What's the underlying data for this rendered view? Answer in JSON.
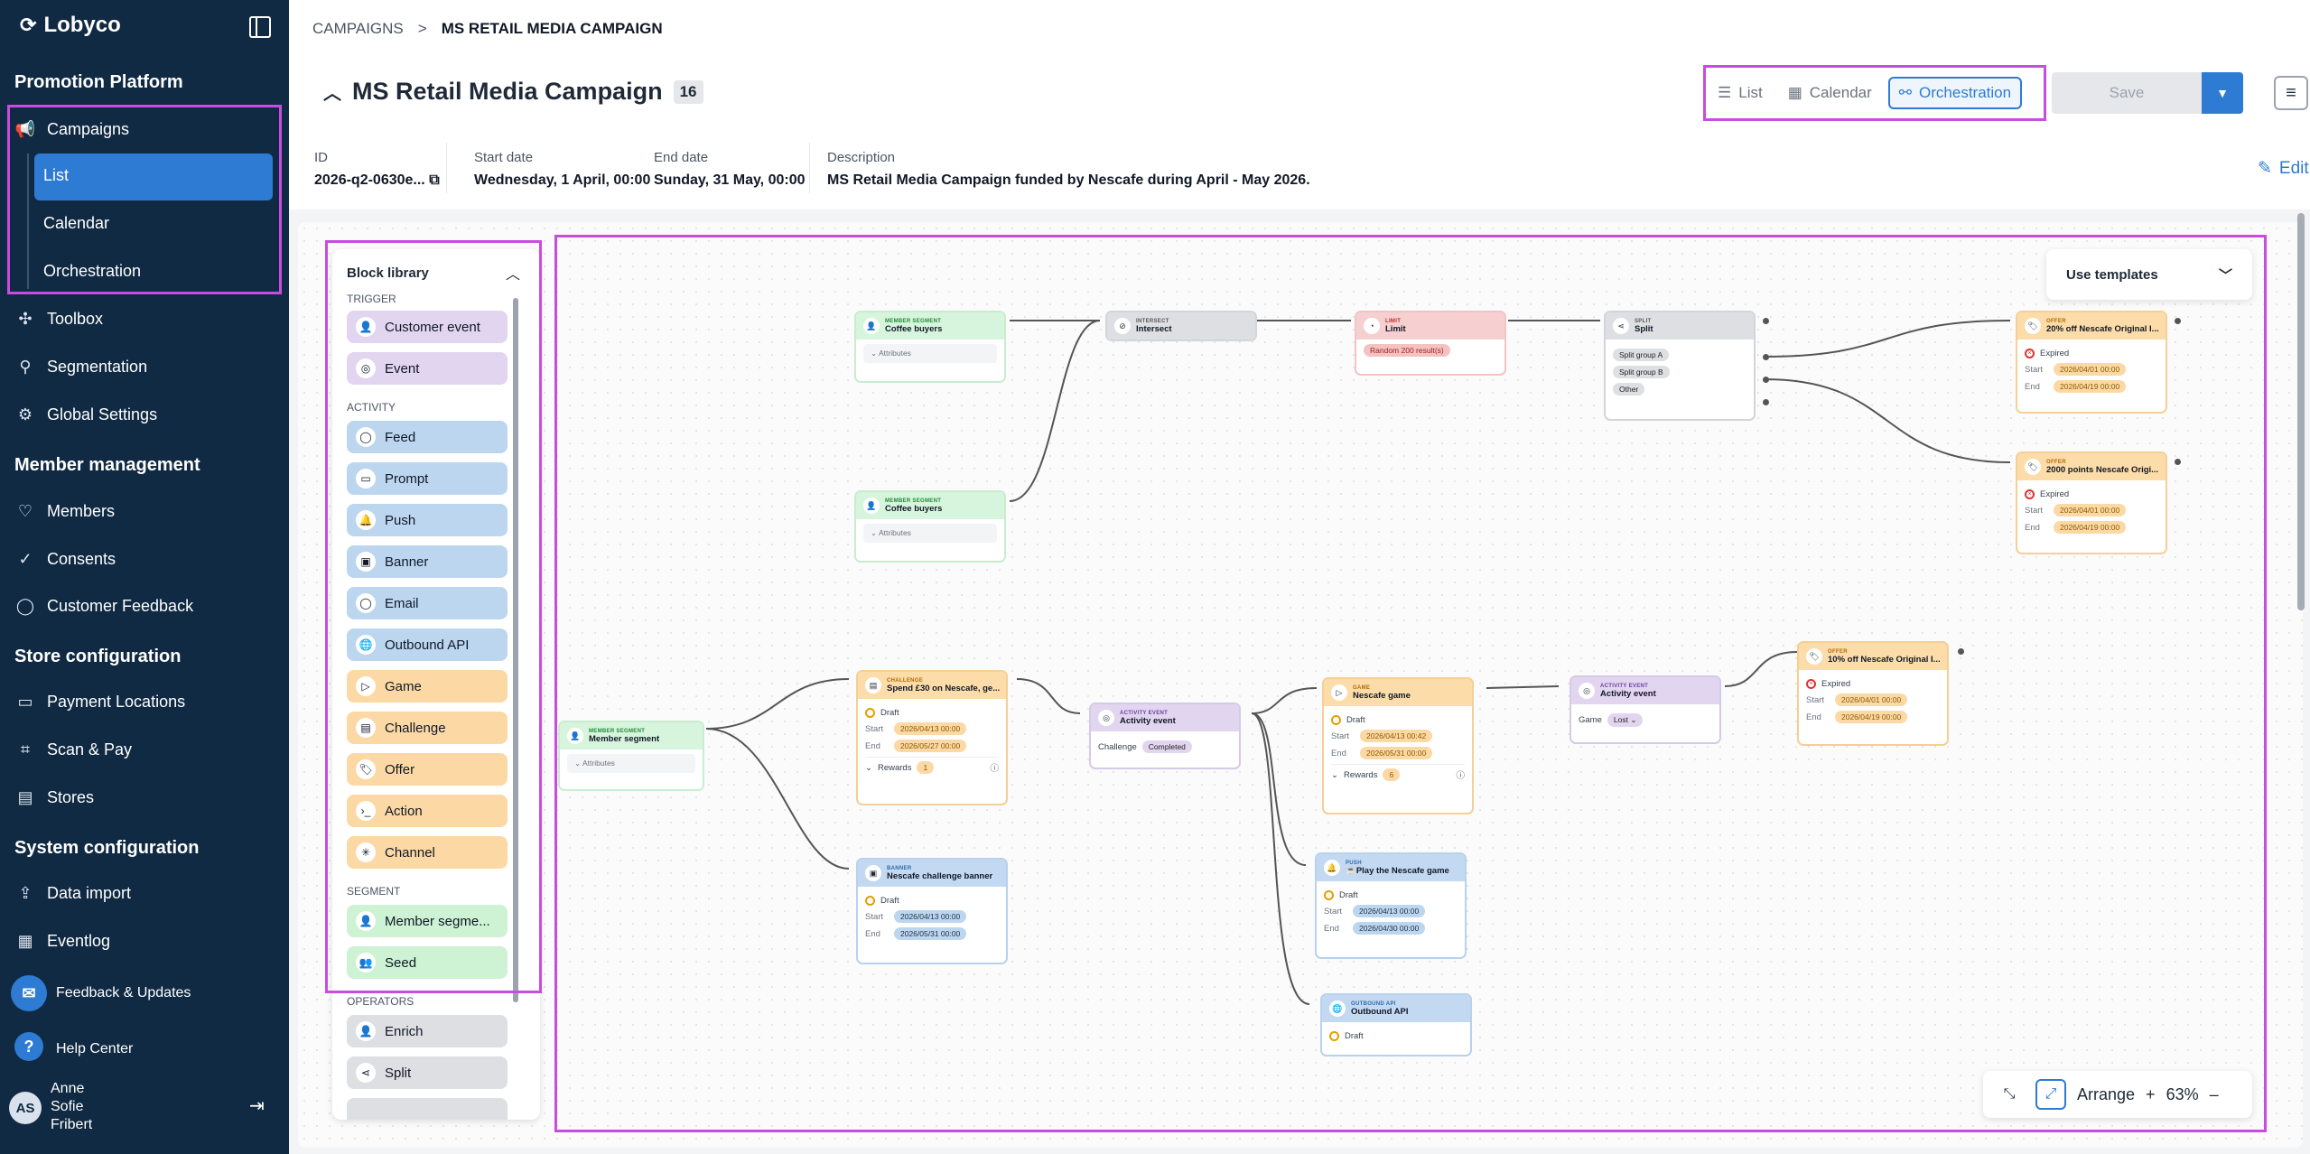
{
  "app": {
    "logo": "Lobyco"
  },
  "sidebar": {
    "sections": [
      "Promotion Platform",
      "Member management",
      "Store configuration",
      "System configuration"
    ],
    "campaigns": "Campaigns",
    "sub_items": [
      "List",
      "Calendar",
      "Orchestration"
    ],
    "toolbox": "Toolbox",
    "segmentation": "Segmentation",
    "global_settings": "Global Settings",
    "members": "Members",
    "consents": "Consents",
    "customer_feedback": "Customer Feedback",
    "payment_locations": "Payment Locations",
    "scan_pay": "Scan & Pay",
    "stores": "Stores",
    "data_import": "Data import",
    "eventlog": "Eventlog",
    "feedback_updates": "Feedback & Updates",
    "help_center": "Help Center",
    "user_initials": "AS",
    "user_name": [
      "Anne",
      "Sofie",
      "Fribert"
    ]
  },
  "breadcrumb": {
    "root": "CAMPAIGNS",
    "sep": ">",
    "current": "MS RETAIL MEDIA CAMPAIGN"
  },
  "campaign": {
    "title": "MS Retail Media Campaign",
    "count": "16",
    "id_label": "ID",
    "id_value": "2026-q2-0630e...",
    "start_label": "Start date",
    "start_value": "Wednesday, 1 April, 00:00",
    "end_label": "End date",
    "end_value": "Sunday, 31 May, 00:00",
    "desc_label": "Description",
    "desc_value": "MS Retail Media Campaign funded by Nescafe during April - May 2026.",
    "edit": "Edit"
  },
  "views": {
    "list": "List",
    "calendar": "Calendar",
    "orchestration": "Orchestration",
    "active": "Orchestration"
  },
  "save": "Save",
  "library": {
    "title": "Block library",
    "trigger_label": "TRIGGER",
    "trigger": [
      "Customer event",
      "Event"
    ],
    "activity_label": "ACTIVITY",
    "activity_blue": [
      "Feed",
      "Prompt",
      "Push",
      "Banner",
      "Email",
      "Outbound API"
    ],
    "activity_orange": [
      "Game",
      "Challenge",
      "Offer",
      "Action",
      "Channel"
    ],
    "segment_label": "SEGMENT",
    "segment": [
      "Member segme...",
      "Seed"
    ],
    "operators_label": "OPERATORS",
    "operators": [
      "Enrich",
      "Split"
    ]
  },
  "templates": "Use templates",
  "zoom": {
    "arrange": "Arrange",
    "level": "63%",
    "plus": "+",
    "minus": "–"
  },
  "nodes": {
    "seg1": {
      "type": "MEMBER SEGMENT",
      "name": "Coffee buyers",
      "attr": "Attributes"
    },
    "seg2": {
      "type": "MEMBER SEGMENT",
      "name": "Coffee buyers",
      "attr": "Attributes"
    },
    "intersect": {
      "type": "INTERSECT",
      "name": "Intersect"
    },
    "limit": {
      "type": "LIMIT",
      "name": "Limit",
      "pill": "Random 200 result(s)"
    },
    "split": {
      "type": "SPLIT",
      "name": "Split",
      "groups": [
        "Split group A",
        "Split group B",
        "Other"
      ]
    },
    "offer1": {
      "type": "OFFER",
      "name": "20% off Nescafe Original I...",
      "status": "Expired",
      "start": "2026/04/01 00:00",
      "end": "2026/04/19 00:00"
    },
    "offer2": {
      "type": "OFFER",
      "name": "2000 points Nescafe Origi...",
      "status": "Expired",
      "start": "2026/04/01 00:00",
      "end": "2026/04/19 00:00"
    },
    "seg3": {
      "type": "MEMBER SEGMENT",
      "name": "Member segment",
      "attr": "Attributes"
    },
    "challenge": {
      "type": "CHALLENGE",
      "name": "Spend £30 on Nescafe, ge...",
      "status": "Draft",
      "start": "2026/04/13 00:00",
      "end": "2026/05/27 00:00",
      "rewards": "Rewards",
      "rewards_n": "1"
    },
    "banner": {
      "type": "BANNER",
      "name": "Nescafe challenge banner",
      "status": "Draft",
      "start": "2026/04/13 00:00",
      "end": "2026/05/31 00:00"
    },
    "activity1": {
      "type": "ACTIVITY EVENT",
      "name": "Activity event",
      "label": "Challenge",
      "pill": "Completed"
    },
    "game": {
      "type": "GAME",
      "name": "Nescafe game",
      "status": "Draft",
      "start": "2026/04/13 00:42",
      "end": "2026/05/31 00:00",
      "rewards": "Rewards",
      "rewards_n": "6"
    },
    "push": {
      "type": "PUSH",
      "name": "☕Play the Nescafe game",
      "status": "Draft",
      "start": "2026/04/13 00:00",
      "end": "2026/04/30 00:00"
    },
    "outbound": {
      "type": "OUTBOUND API",
      "name": "Outbound API",
      "status": "Draft"
    },
    "activity2": {
      "type": "ACTIVITY EVENT",
      "name": "Activity event",
      "label": "Game",
      "pill": "Lost"
    },
    "offer3": {
      "type": "OFFER",
      "name": "10% off Nescafe Original I...",
      "status": "Expired",
      "start": "2026/04/01 00:00",
      "end": "2026/04/19 00:00"
    }
  },
  "labels": {
    "start": "Start",
    "end": "End"
  },
  "colors": {
    "sidebar": "#102a43",
    "accent": "#2e7bd4",
    "highlight": "#c74ce0"
  }
}
